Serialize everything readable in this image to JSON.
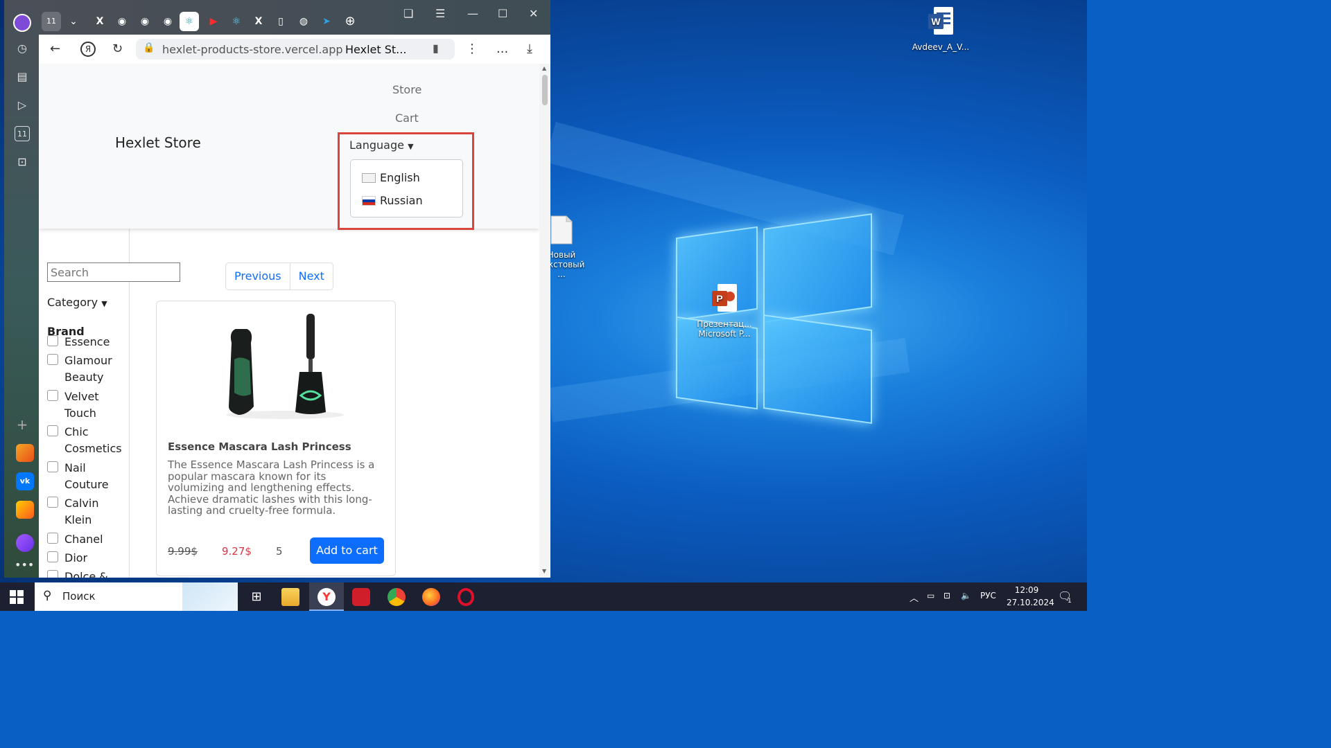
{
  "browser": {
    "tab_count_badge": "11",
    "url": "hexlet-products-store.vercel.app",
    "page_title": "Hexlet St...",
    "more_label": "..."
  },
  "store": {
    "brand": "Hexlet Store",
    "nav": {
      "store": "Store",
      "cart": "Cart"
    },
    "language": {
      "toggle": "Language",
      "options": [
        "English",
        "Russian"
      ]
    },
    "filters": {
      "search_placeholder": "Search",
      "category": "Category",
      "brand_heading": "Brand",
      "brands": [
        [
          "Essence"
        ],
        [
          "Glamour",
          "Beauty"
        ],
        [
          "Velvet",
          "Touch"
        ],
        [
          "Chic",
          "Cosmetics"
        ],
        [
          "Nail",
          "Couture"
        ],
        [
          "Calvin",
          "Klein"
        ],
        [
          "Chanel"
        ],
        [
          "Dior"
        ],
        [
          "Dolce &"
        ]
      ]
    },
    "pager": {
      "previous": "Previous",
      "next": "Next"
    },
    "product": {
      "title": "Essence Mascara Lash Princess",
      "description": "The Essence Mascara Lash Princess is a popular mascara known for its volumizing and lengthening effects. Achieve dramatic lashes with this long-lasting and cruelty-free formula.",
      "old_price": "9.99$",
      "price": "9.27$",
      "rating": "5",
      "add_to_cart": "Add to cart"
    }
  },
  "desktop": {
    "icons": [
      {
        "label": "Avdeev_A_V...",
        "type": "word"
      },
      {
        "label": "Новый текстовый ...",
        "type": "text-file"
      },
      {
        "label": "Презентац... Microsoft P...",
        "type": "powerpoint"
      }
    ]
  },
  "taskbar": {
    "search_placeholder": "Поиск",
    "language": "РУС",
    "time": "12:09",
    "date": "27.10.2024",
    "notification_count": "1"
  }
}
